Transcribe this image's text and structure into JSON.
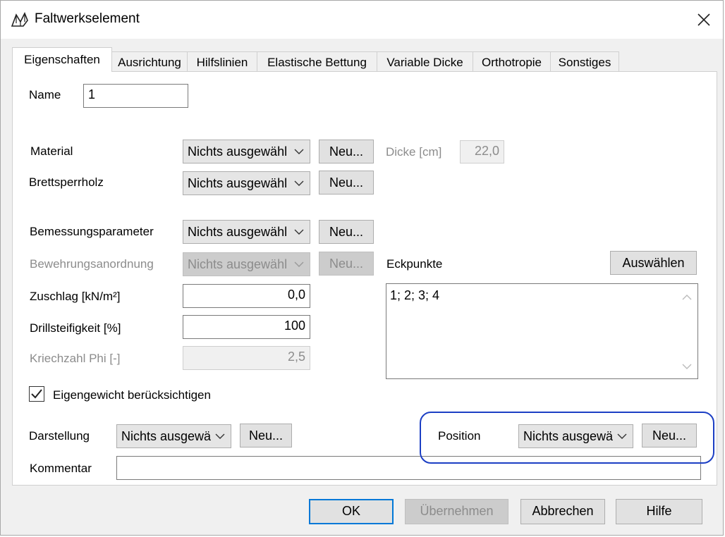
{
  "window": {
    "title": "Faltwerkselement",
    "icon": "folded-plate-icon",
    "close": "close-icon"
  },
  "tabs": [
    {
      "label": "Eigenschaften",
      "active": true
    },
    {
      "label": "Ausrichtung"
    },
    {
      "label": "Hilfslinien"
    },
    {
      "label": "Elastische Bettung"
    },
    {
      "label": "Variable Dicke"
    },
    {
      "label": "Orthotropie"
    },
    {
      "label": "Sonstiges"
    }
  ],
  "form": {
    "name_label": "Name",
    "name_value": "1",
    "material_label": "Material",
    "material_value": "Nichts ausgewähl",
    "material_new": "Neu...",
    "dicke_label": "Dicke [cm]",
    "dicke_value": "22,0",
    "brettsperrholz_label": "Brettsperrholz",
    "brettsperrholz_value": "Nichts ausgewähl",
    "brettsperrholz_new": "Neu...",
    "bemessung_label": "Bemessungsparameter",
    "bemessung_value": "Nichts ausgewähl",
    "bemessung_new": "Neu...",
    "bewehrung_label": "Bewehrungsanordnung",
    "bewehrung_value": "Nichts ausgewähl",
    "bewehrung_new": "Neu...",
    "zuschlag_label": "Zuschlag [kN/m²]",
    "zuschlag_value": "0,0",
    "drill_label": "Drillsteifigkeit [%]",
    "drill_value": "100",
    "kriech_label": "Kriechzahl Phi [-]",
    "kriech_value": "2,5",
    "eckpunkte_label": "Eckpunkte",
    "eckpunkte_button": "Auswählen",
    "eckpunkte_value": "1; 2; 3; 4",
    "eigengewicht_label": "Eigengewicht berücksichtigen",
    "eigengewicht_checked": true,
    "darstellung_label": "Darstellung",
    "darstellung_value": "Nichts ausgewä",
    "darstellung_new": "Neu...",
    "position_label": "Position",
    "position_value": "Nichts ausgewä",
    "position_new": "Neu...",
    "kommentar_label": "Kommentar",
    "kommentar_value": ""
  },
  "buttons": {
    "ok": "OK",
    "apply": "Übernehmen",
    "cancel": "Abbrechen",
    "help": "Hilfe"
  },
  "colors": {
    "highlight": "#1c3fc4",
    "focus": "#0078d7"
  }
}
